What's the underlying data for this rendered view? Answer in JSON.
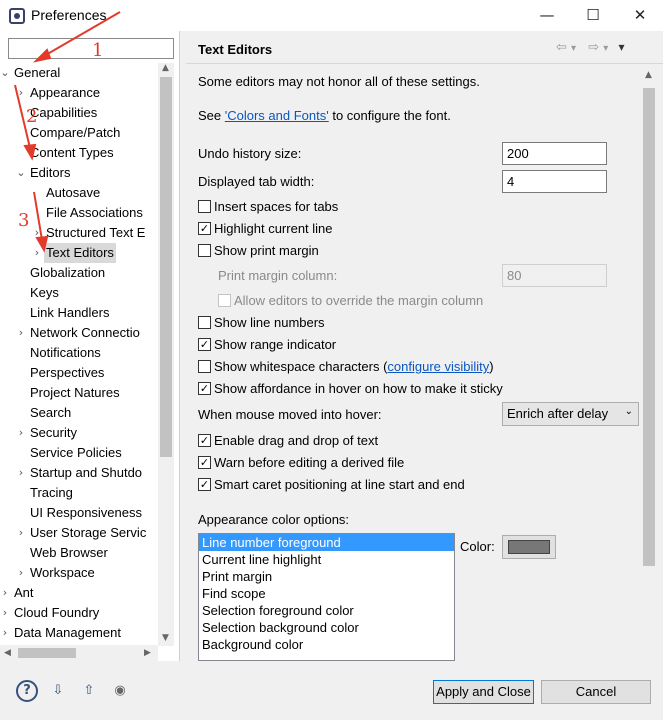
{
  "window": {
    "title": "Preferences",
    "minimize_label": "—",
    "maximize_label": "☐",
    "close_label": "✕"
  },
  "tree": {
    "items": [
      {
        "label": "General",
        "expander": "⌄"
      },
      {
        "label": "Appearance",
        "expander": "›"
      },
      {
        "label": "Capabilities",
        "expander": ""
      },
      {
        "label": "Compare/Patch",
        "expander": ""
      },
      {
        "label": "Content Types",
        "expander": ""
      },
      {
        "label": "Editors",
        "expander": "⌄"
      },
      {
        "label": "Autosave",
        "expander": ""
      },
      {
        "label": "File Associations",
        "expander": ""
      },
      {
        "label": "Structured Text E",
        "expander": "›"
      },
      {
        "label": "Text Editors",
        "expander": "›"
      },
      {
        "label": "Globalization",
        "expander": ""
      },
      {
        "label": "Keys",
        "expander": ""
      },
      {
        "label": "Link Handlers",
        "expander": ""
      },
      {
        "label": "Network Connectio",
        "expander": "›"
      },
      {
        "label": "Notifications",
        "expander": ""
      },
      {
        "label": "Perspectives",
        "expander": ""
      },
      {
        "label": "Project Natures",
        "expander": ""
      },
      {
        "label": "Search",
        "expander": ""
      },
      {
        "label": "Security",
        "expander": "›"
      },
      {
        "label": "Service Policies",
        "expander": ""
      },
      {
        "label": "Startup and Shutdo",
        "expander": "›"
      },
      {
        "label": "Tracing",
        "expander": ""
      },
      {
        "label": "UI Responsiveness",
        "expander": ""
      },
      {
        "label": "User Storage Servic",
        "expander": "›"
      },
      {
        "label": "Web Browser",
        "expander": ""
      },
      {
        "label": "Workspace",
        "expander": "›"
      },
      {
        "label": "Ant",
        "expander": "›"
      },
      {
        "label": "Cloud Foundry",
        "expander": "›"
      },
      {
        "label": "Data Management",
        "expander": "›"
      }
    ]
  },
  "page": {
    "title": "Text Editors",
    "nav": {
      "back": "⇦",
      "back_menu": "▾",
      "forward": "⇨",
      "forward_menu": "▾",
      "view_menu": "▾"
    },
    "note": "Some editors may not honor all of these settings.",
    "see_prefix": "See ",
    "colors_fonts_link": "'Colors and Fonts'",
    "see_suffix": " to configure the font.",
    "undo_label": "Undo history size:",
    "undo_value": "200",
    "tab_label": "Displayed tab width:",
    "tab_value": "4",
    "insert_spaces": {
      "label": "Insert spaces for tabs",
      "mark": ""
    },
    "highlight_line": {
      "label": "Highlight current line",
      "mark": "✓"
    },
    "print_margin": {
      "label": "Show print margin",
      "mark": ""
    },
    "margin_column_label": "Print margin column:",
    "margin_column_value": "80",
    "allow_override": {
      "label": "Allow editors to override the margin column",
      "mark": ""
    },
    "line_numbers": {
      "label": "Show line numbers",
      "mark": ""
    },
    "range_indicator": {
      "label": "Show range indicator",
      "mark": "✓"
    },
    "whitespace": {
      "label": "Show whitespace characters (",
      "link": "configure visibility",
      "suffix": ")",
      "mark": ""
    },
    "affordance": {
      "label": "Show affordance in hover on how to make it sticky",
      "mark": "✓"
    },
    "hover_label": "When mouse moved into hover:",
    "hover_value": "Enrich after delay",
    "drag_drop": {
      "label": "Enable drag and drop of text",
      "mark": "✓"
    },
    "warn_derived": {
      "label": "Warn before editing a derived file",
      "mark": "✓"
    },
    "smart_caret": {
      "label": "Smart caret positioning at line start and end",
      "mark": "✓"
    },
    "appearance_label": "Appearance color options:",
    "color_options": [
      "Line number foreground",
      "Current line highlight",
      "Print margin",
      "Find scope",
      "Selection foreground color",
      "Selection background color",
      "Background color"
    ],
    "color_label": "Color:",
    "color_swatch": "#777777"
  },
  "footer": {
    "help_icon": "?",
    "import_icon": "⇩",
    "export_icon": "⇧",
    "record_icon": "◉",
    "apply_close": "Apply and Close",
    "cancel": "Cancel"
  },
  "annotations": {
    "one": "1",
    "two": "2",
    "three": "3"
  },
  "colors": {
    "accent": "#3399ff",
    "annotation": "#e23b2c",
    "link": "#0a56c2"
  }
}
